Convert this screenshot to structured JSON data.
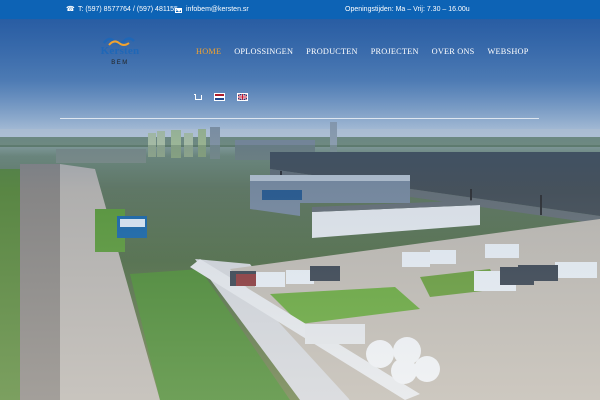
{
  "topbar": {
    "phone": "T: (597) 8577764 / (597) 481155",
    "email": "infobem@kersten.sr",
    "hours": "Openingstijden: Ma – Vrij: 7.30 – 16.00u"
  },
  "logo": {
    "brand": "Kersten",
    "subtitle": "BEM"
  },
  "nav": [
    "HOME",
    "OPLOSSINGEN",
    "PRODUCTEN",
    "PROJECTEN",
    "OVER ONS",
    "WEBSHOP"
  ],
  "nav_active": "HOME",
  "icons": [
    "phone-icon",
    "mail-icon",
    "cart-icon",
    "flag-nl-icon",
    "flag-en-icon"
  ],
  "colors": {
    "topbar": "#0d63b5",
    "nav_active": "#f2a32f",
    "nav_text": "#ffffff",
    "brand": "#1f67b7"
  },
  "hero": {
    "image": "aerial photo of industrial site with warehouses, parking lot and road"
  }
}
